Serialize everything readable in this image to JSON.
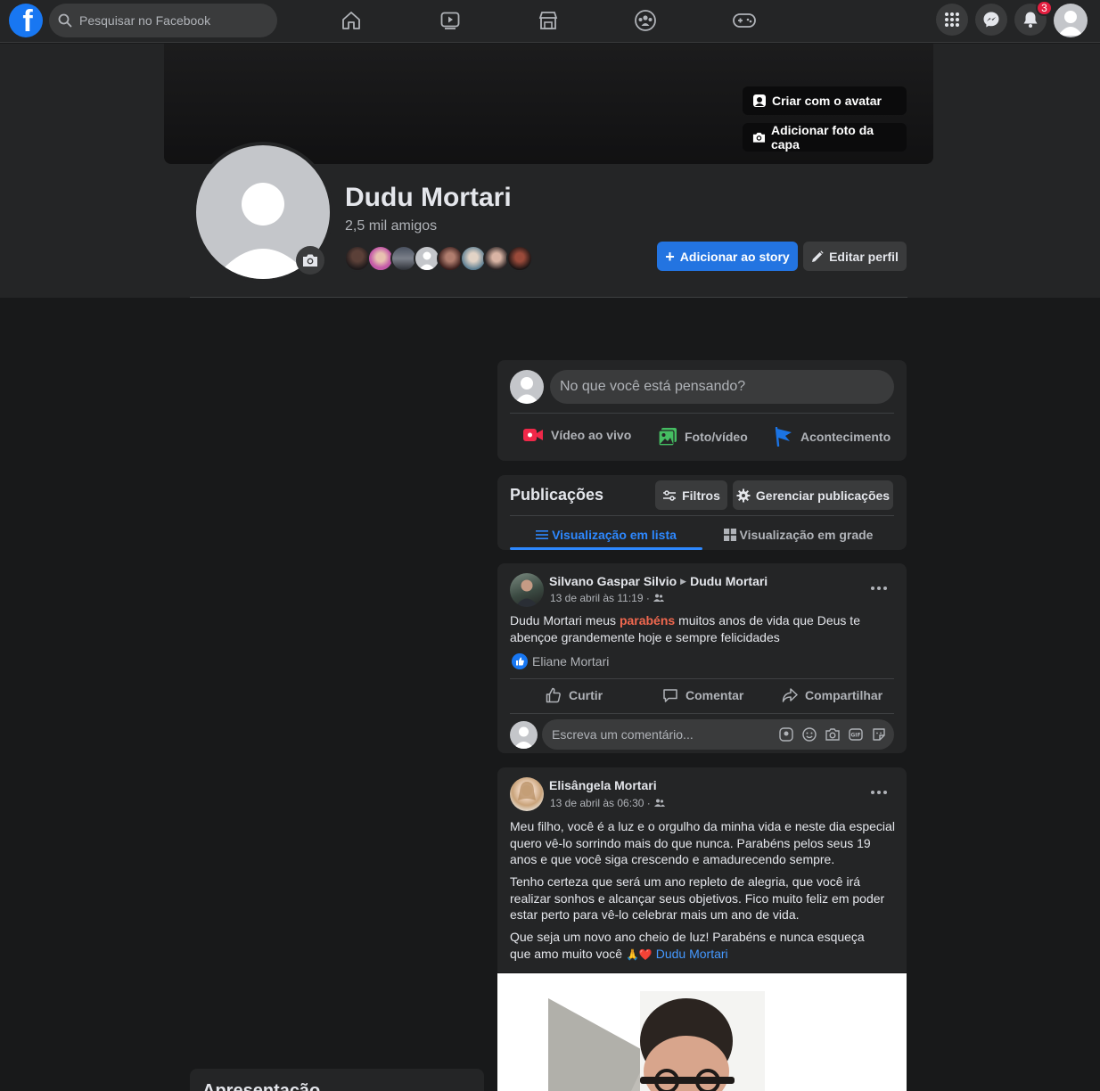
{
  "nav": {
    "logo_letter": "f",
    "search_placeholder": "Pesquisar no Facebook",
    "notification_count": "3",
    "icons": [
      "home-icon",
      "watch-icon",
      "marketplace-icon",
      "groups-icon",
      "gaming-icon",
      "menu-grid-icon",
      "messenger-icon",
      "bell-icon"
    ]
  },
  "cover": {
    "avatar_button": "Criar com o avatar",
    "cover_photo_button": "Adicionar foto da capa"
  },
  "profile": {
    "name": "Dudu Mortari",
    "friends_count": "2,5 mil amigos",
    "add_story_button": "Adicionar ao story",
    "edit_profile_button": "Editar perfil"
  },
  "composer": {
    "placeholder": "No que você está pensando?",
    "live_video": "Vídeo ao vivo",
    "photo_video": "Foto/vídeo",
    "life_event": "Acontecimento"
  },
  "posts_header": {
    "title": "Publicações",
    "filters_button": "Filtros",
    "manage_button": "Gerenciar publicações",
    "list_view_tab": "Visualização em lista",
    "grid_view_tab": "Visualização em grade"
  },
  "post1": {
    "author": "Silvano Gaspar Silvio",
    "target": "Dudu Mortari",
    "meta": "13 de abril às 11:19 ·",
    "text_before": "Dudu Mortari meus ",
    "text_highlight": "parabéns",
    "text_after": " muitos anos de vida que Deus te abençoe grandemente hoje e sempre felicidades",
    "liked_by": "Eliane Mortari",
    "like_label": "Curtir",
    "comment_label": "Comentar",
    "share_label": "Compartilhar",
    "comment_placeholder": "Escreva um comentário..."
  },
  "post2": {
    "author": "Elisângela Mortari",
    "meta": "13 de abril às 06:30 ·",
    "paragraph1": "Meu filho, você é a luz e o orgulho da minha vida e neste dia especial quero vê-lo sorrindo mais do que nunca. Parabéns pelos seus 19 anos e que você siga crescendo e amadurecendo sempre.",
    "paragraph2": "Tenho certeza que será um ano repleto de alegria, que você irá realizar sonhos e alcançar seus objetivos. Fico muito feliz em poder estar perto para vê-lo celebrar mais um ano de vida.",
    "paragraph3": "Que seja um novo ano cheio de luz! Parabéns e nunca esqueça que amo muito você",
    "paragraph3_emoji": "🙏❤️",
    "tagged": "Dudu Mortari"
  },
  "intro": {
    "title": "Apresentação"
  },
  "colors": {
    "background": "#18191a",
    "surface": "#242526",
    "accent": "#2374e1",
    "highlight": "#f0684f",
    "badge": "#e41e3f"
  }
}
